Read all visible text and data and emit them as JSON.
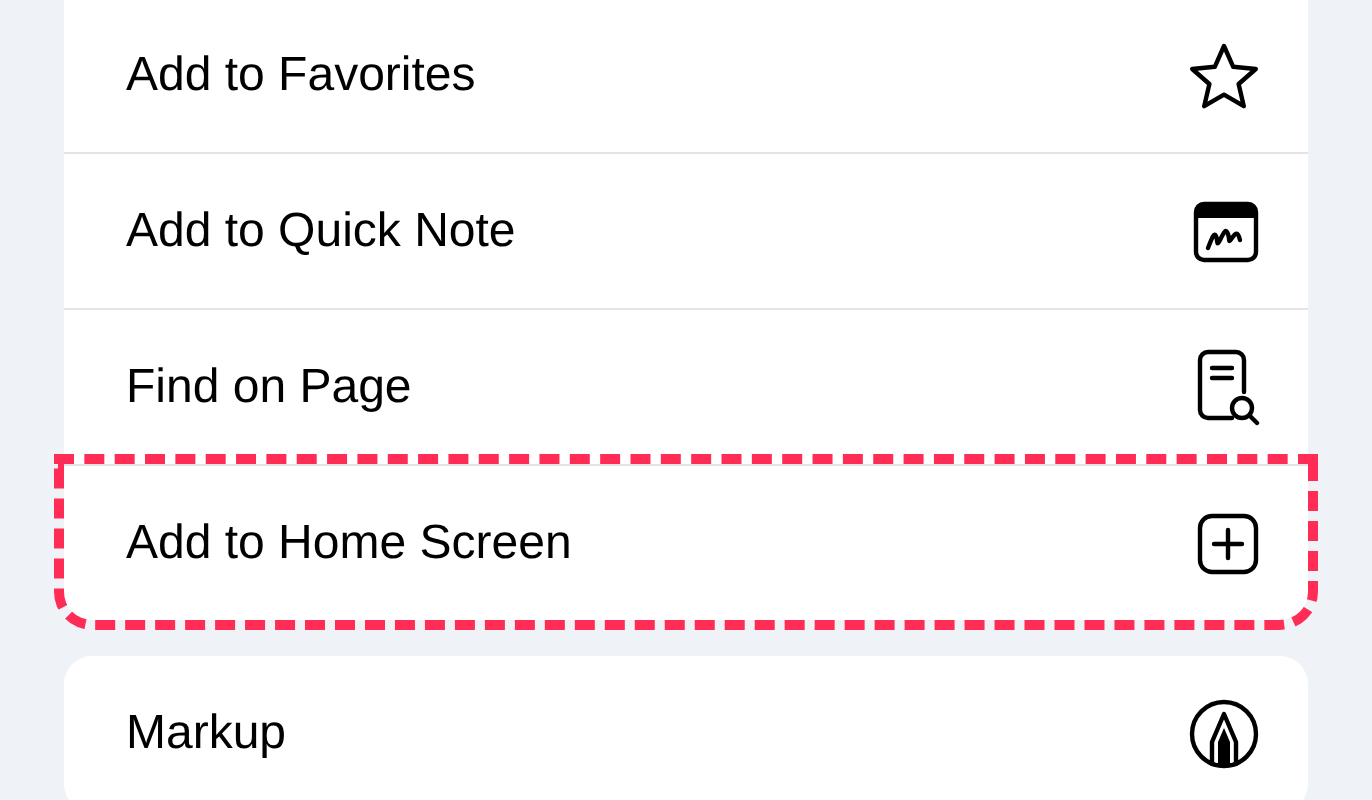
{
  "groups": [
    {
      "items": [
        {
          "label": "Add to Favorites",
          "highlighted": false
        },
        {
          "label": "Add to Quick Note",
          "highlighted": false
        },
        {
          "label": "Find on Page",
          "highlighted": false
        },
        {
          "label": "Add to Home Screen",
          "highlighted": true
        }
      ]
    },
    {
      "items": [
        {
          "label": "Markup",
          "highlighted": false
        }
      ]
    }
  ]
}
